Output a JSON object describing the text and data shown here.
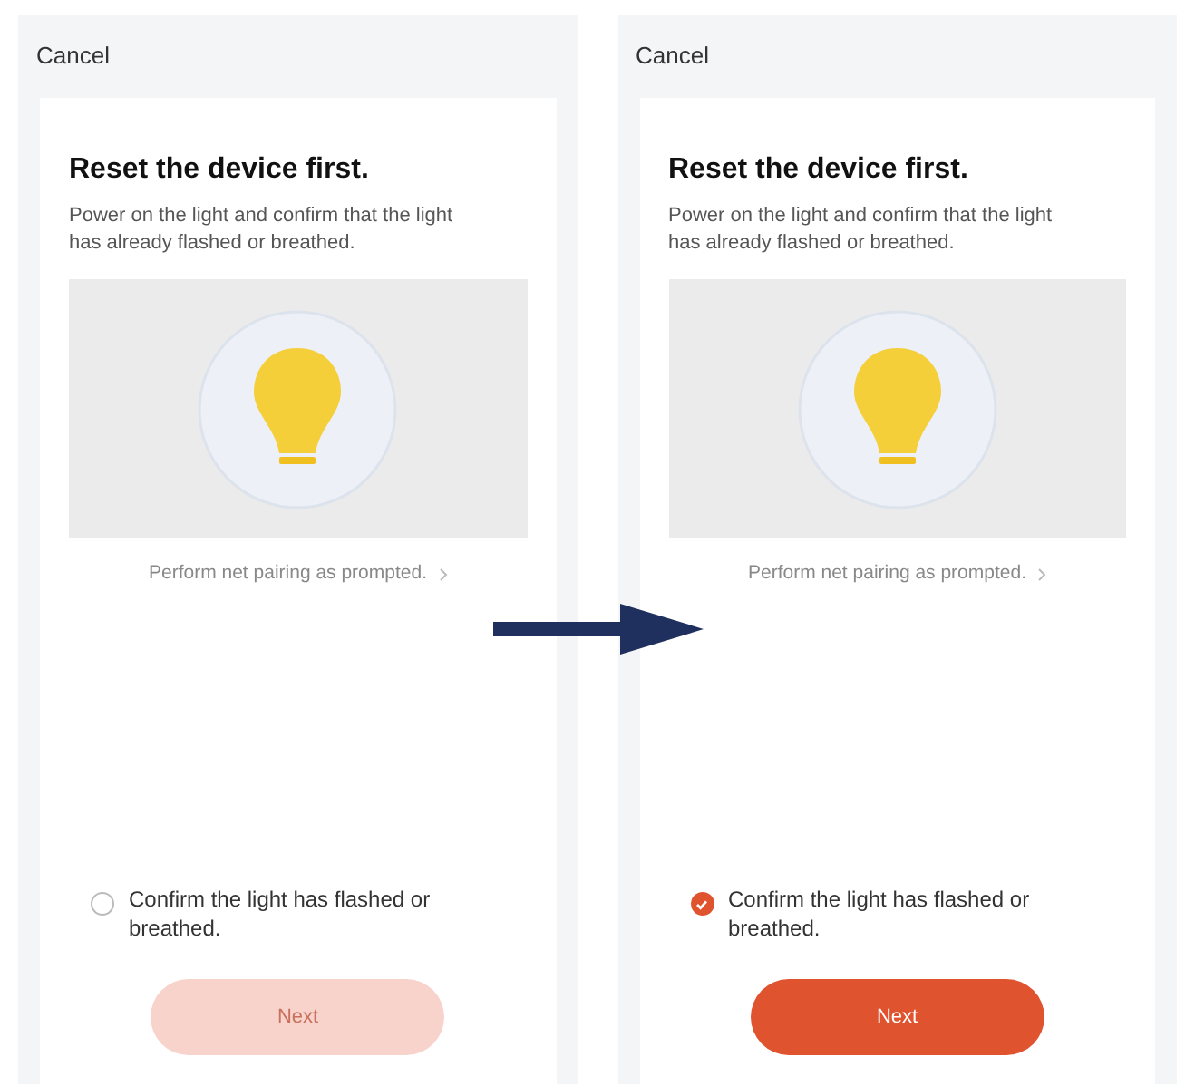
{
  "screens": [
    {
      "cancel": "Cancel",
      "title": "Reset the device first.",
      "description": "Power on the light and confirm that the light has already flashed or breathed.",
      "link": "Perform net pairing as prompted.",
      "confirm": {
        "label": "Confirm the light has flashed or breathed.",
        "checked": false
      },
      "next": {
        "label": "Next",
        "disabled": true
      }
    },
    {
      "cancel": "Cancel",
      "title": "Reset the device first.",
      "description": "Power on the light and confirm that the light has already flashed or breathed.",
      "link": "Perform net pairing as prompted.",
      "confirm": {
        "label": "Confirm the light has flashed or breathed.",
        "checked": true
      },
      "next": {
        "label": "Next",
        "disabled": false
      }
    }
  ]
}
